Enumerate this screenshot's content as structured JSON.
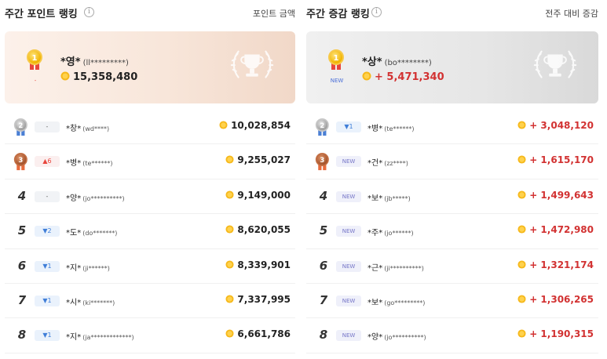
{
  "left": {
    "title": "주간 포인트 랭킹",
    "subtitle": "포인트 금액",
    "top": {
      "rank": "1",
      "change": "-",
      "name": "*영*",
      "masked": "(ll*********)",
      "amount": "15,358,480"
    },
    "rows": [
      {
        "rank": "2",
        "medal": "silver",
        "change": "-",
        "change_type": "same",
        "name": "*창*",
        "masked": "(wd****)",
        "amount": "10,028,854"
      },
      {
        "rank": "3",
        "medal": "bronze",
        "change": "▲6",
        "change_type": "up",
        "name": "*병*",
        "masked": "(te******)",
        "amount": "9,255,027"
      },
      {
        "rank": "4",
        "medal": "",
        "change": "-",
        "change_type": "same",
        "name": "*양*",
        "masked": "(jo**********)",
        "amount": "9,149,000"
      },
      {
        "rank": "5",
        "medal": "",
        "change": "▼2",
        "change_type": "down",
        "name": "*도*",
        "masked": "(do*******)",
        "amount": "8,620,055"
      },
      {
        "rank": "6",
        "medal": "",
        "change": "▼1",
        "change_type": "down",
        "name": "*지*",
        "masked": "(ji******)",
        "amount": "8,339,901"
      },
      {
        "rank": "7",
        "medal": "",
        "change": "▼1",
        "change_type": "down",
        "name": "*시*",
        "masked": "(ki*******)",
        "amount": "7,337,995"
      },
      {
        "rank": "8",
        "medal": "",
        "change": "▼1",
        "change_type": "down",
        "name": "*지*",
        "masked": "(ja*************)",
        "amount": "6,661,786"
      }
    ]
  },
  "right": {
    "title": "주간 증감 랭킹",
    "subtitle": "전주 대비 증감",
    "top": {
      "rank": "1",
      "change": "NEW",
      "name": "*상*",
      "masked": "(bo********)",
      "amount": "+ 5,471,340"
    },
    "rows": [
      {
        "rank": "2",
        "medal": "silver",
        "change": "▼1",
        "change_type": "down",
        "name": "*병*",
        "masked": "(te******)",
        "amount": "+ 3,048,120"
      },
      {
        "rank": "3",
        "medal": "bronze",
        "change": "NEW",
        "change_type": "new",
        "name": "*건*",
        "masked": "(zz****)",
        "amount": "+ 1,615,170"
      },
      {
        "rank": "4",
        "medal": "",
        "change": "NEW",
        "change_type": "new",
        "name": "*보*",
        "masked": "(jb*****)",
        "amount": "+ 1,499,643"
      },
      {
        "rank": "5",
        "medal": "",
        "change": "NEW",
        "change_type": "new",
        "name": "*주*",
        "masked": "(jo******)",
        "amount": "+ 1,472,980"
      },
      {
        "rank": "6",
        "medal": "",
        "change": "NEW",
        "change_type": "new",
        "name": "*근*",
        "masked": "(ji**********)",
        "amount": "+ 1,321,174"
      },
      {
        "rank": "7",
        "medal": "",
        "change": "NEW",
        "change_type": "new",
        "name": "*보*",
        "masked": "(go*********)",
        "amount": "+ 1,306,265"
      },
      {
        "rank": "8",
        "medal": "",
        "change": "NEW",
        "change_type": "new",
        "name": "*양*",
        "masked": "(jo**********)",
        "amount": "+ 1,190,315"
      }
    ]
  },
  "icons": {
    "info": "info-icon",
    "coin": "coin-icon",
    "trophy": "trophy-icon"
  },
  "colors": {
    "accent_red": "#d23232",
    "down_blue": "#3f7ed8",
    "up_red": "#e8453c",
    "new_purple": "#7575c8"
  }
}
